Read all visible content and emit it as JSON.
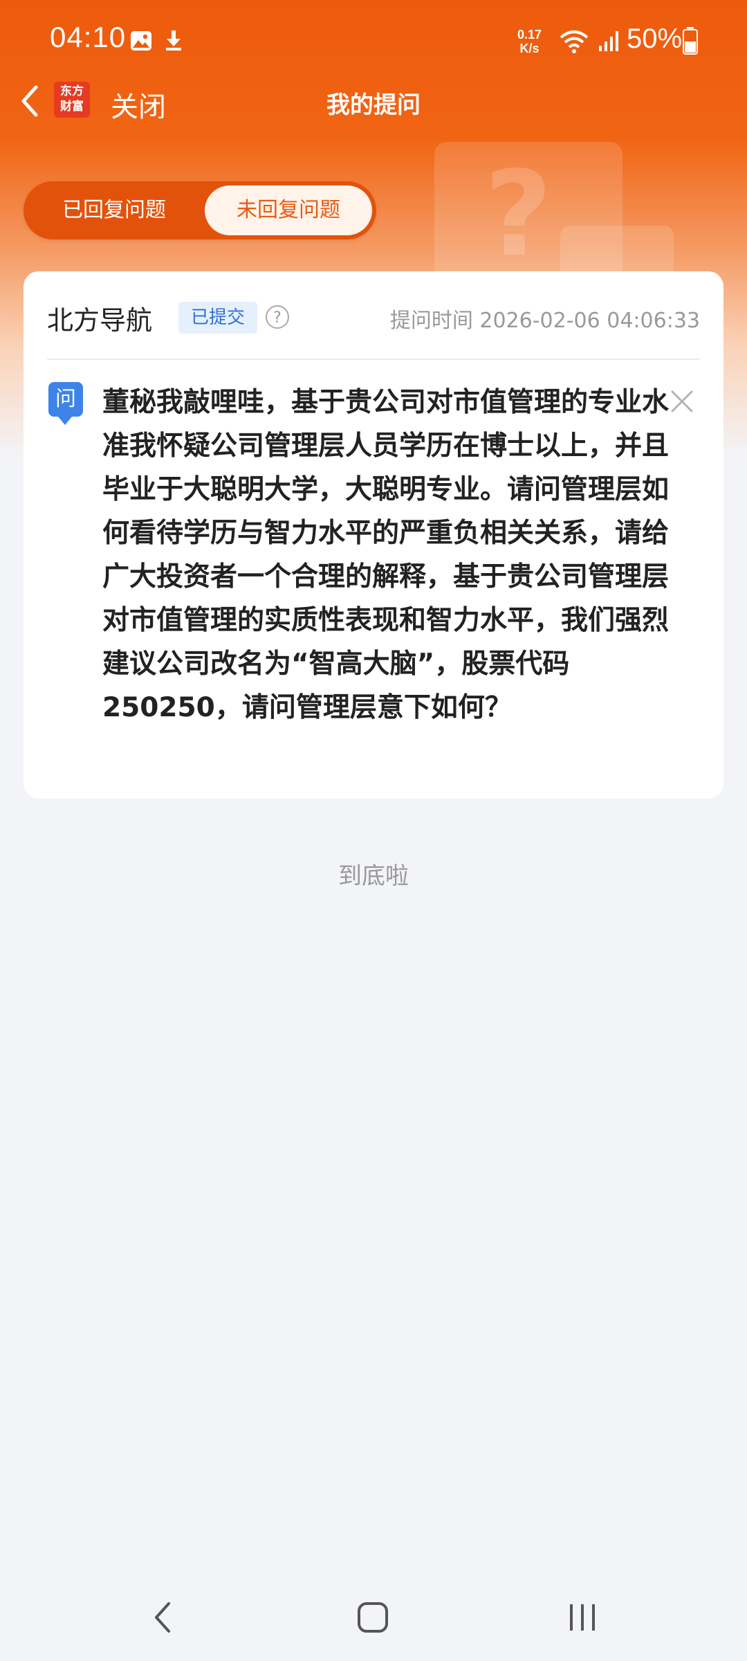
{
  "status_bar": {
    "time": "04:10",
    "net_speed_value": "0.17",
    "net_speed_unit": "K/s",
    "battery": "50%",
    "icons": [
      "image-icon",
      "download-icon",
      "wifi-icon",
      "signal-icon",
      "battery-icon"
    ]
  },
  "header": {
    "logo_text_line1": "东方",
    "logo_text_line2": "财富",
    "close_label": "关闭",
    "title": "我的提问"
  },
  "tabs": [
    {
      "label": "已回复问题",
      "active": false
    },
    {
      "label": "未回复问题",
      "active": true
    }
  ],
  "card": {
    "company": "北方导航",
    "status": "已提交",
    "ask_time": "提问时间 2026-02-06 04:06:33",
    "q_icon_label": "问",
    "question": "董秘我敲哩哇，基于贵公司对市值管理的专业水准我怀疑公司管理层人员学历在博士以上，并且毕业于大聪明大学，大聪明专业。请问管理层如何看待学历与智力水平的严重负相关关系，请给广大投资者一个合理的解释，基于贵公司管理层对市值管理的实质性表现和智力水平，我们强烈建议公司改名为“智高大脑”，股票代码250250，请问管理层意下如何？"
  },
  "footer": {
    "end_text": "到底啦"
  },
  "colors": {
    "brand_orange": "#ee5a0c",
    "badge_blue": "#2f6fd6",
    "q_icon_blue": "#3e84e8"
  }
}
